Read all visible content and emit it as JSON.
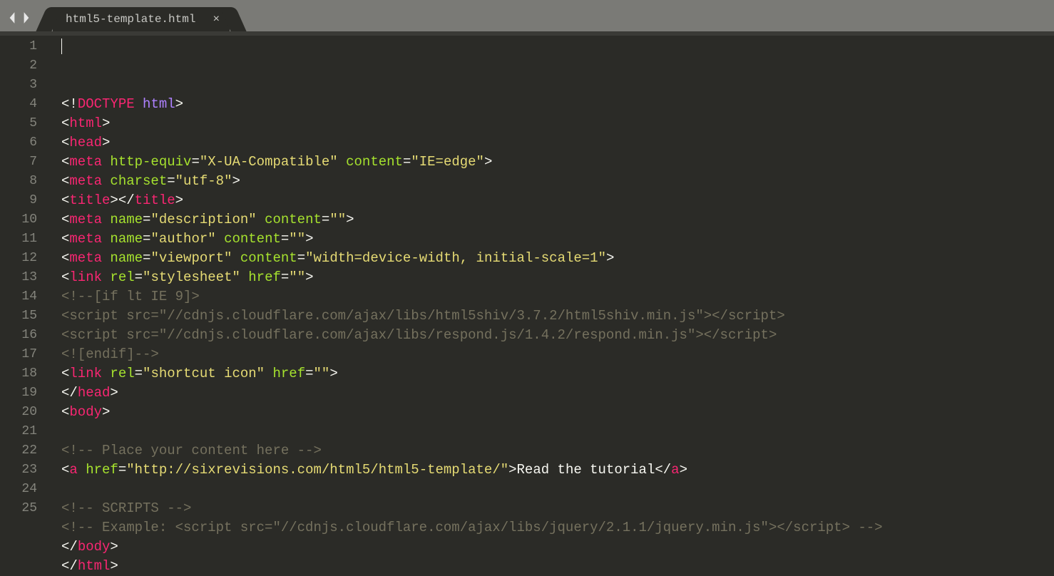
{
  "tab": {
    "filename": "html5-template.html",
    "close_glyph": "×"
  },
  "gutter_start": 1,
  "gutter_end": 25,
  "code": [
    [
      [
        "p-white",
        "<!"
      ],
      [
        "p-pink",
        "DOCTYPE"
      ],
      [
        "p-white",
        " "
      ],
      [
        "p-purple",
        "html"
      ],
      [
        "p-white",
        ">"
      ]
    ],
    [
      [
        "p-white",
        "<"
      ],
      [
        "p-pink",
        "html"
      ],
      [
        "p-white",
        ">"
      ]
    ],
    [
      [
        "p-white",
        "<"
      ],
      [
        "p-pink",
        "head"
      ],
      [
        "p-white",
        ">"
      ]
    ],
    [
      [
        "p-white",
        "<"
      ],
      [
        "p-pink",
        "meta"
      ],
      [
        "p-white",
        " "
      ],
      [
        "p-green",
        "http-equiv"
      ],
      [
        "p-white",
        "="
      ],
      [
        "p-yellow",
        "\"X-UA-Compatible\""
      ],
      [
        "p-white",
        " "
      ],
      [
        "p-green",
        "content"
      ],
      [
        "p-white",
        "="
      ],
      [
        "p-yellow",
        "\"IE=edge\""
      ],
      [
        "p-white",
        ">"
      ]
    ],
    [
      [
        "p-white",
        "<"
      ],
      [
        "p-pink",
        "meta"
      ],
      [
        "p-white",
        " "
      ],
      [
        "p-green",
        "charset"
      ],
      [
        "p-white",
        "="
      ],
      [
        "p-yellow",
        "\"utf-8\""
      ],
      [
        "p-white",
        ">"
      ]
    ],
    [
      [
        "p-white",
        "<"
      ],
      [
        "p-pink",
        "title"
      ],
      [
        "p-white",
        "></"
      ],
      [
        "p-pink",
        "title"
      ],
      [
        "p-white",
        ">"
      ]
    ],
    [
      [
        "p-white",
        "<"
      ],
      [
        "p-pink",
        "meta"
      ],
      [
        "p-white",
        " "
      ],
      [
        "p-green",
        "name"
      ],
      [
        "p-white",
        "="
      ],
      [
        "p-yellow",
        "\"description\""
      ],
      [
        "p-white",
        " "
      ],
      [
        "p-green",
        "content"
      ],
      [
        "p-white",
        "="
      ],
      [
        "p-yellow",
        "\"\""
      ],
      [
        "p-white",
        ">"
      ]
    ],
    [
      [
        "p-white",
        "<"
      ],
      [
        "p-pink",
        "meta"
      ],
      [
        "p-white",
        " "
      ],
      [
        "p-green",
        "name"
      ],
      [
        "p-white",
        "="
      ],
      [
        "p-yellow",
        "\"author\""
      ],
      [
        "p-white",
        " "
      ],
      [
        "p-green",
        "content"
      ],
      [
        "p-white",
        "="
      ],
      [
        "p-yellow",
        "\"\""
      ],
      [
        "p-white",
        ">"
      ]
    ],
    [
      [
        "p-white",
        "<"
      ],
      [
        "p-pink",
        "meta"
      ],
      [
        "p-white",
        " "
      ],
      [
        "p-green",
        "name"
      ],
      [
        "p-white",
        "="
      ],
      [
        "p-yellow",
        "\"viewport\""
      ],
      [
        "p-white",
        " "
      ],
      [
        "p-green",
        "content"
      ],
      [
        "p-white",
        "="
      ],
      [
        "p-yellow",
        "\"width=device-width, initial-scale=1\""
      ],
      [
        "p-white",
        ">"
      ]
    ],
    [
      [
        "p-white",
        "<"
      ],
      [
        "p-pink",
        "link"
      ],
      [
        "p-white",
        " "
      ],
      [
        "p-green",
        "rel"
      ],
      [
        "p-white",
        "="
      ],
      [
        "p-yellow",
        "\"stylesheet\""
      ],
      [
        "p-white",
        " "
      ],
      [
        "p-green",
        "href"
      ],
      [
        "p-white",
        "="
      ],
      [
        "p-yellow",
        "\"\""
      ],
      [
        "p-white",
        ">"
      ]
    ],
    [
      [
        "p-gray",
        "<!--[if lt IE 9]>"
      ]
    ],
    [
      [
        "p-gray",
        "<script src=\"//cdnjs.cloudflare.com/ajax/libs/html5shiv/3.7.2/html5shiv.min.js\"></script>"
      ]
    ],
    [
      [
        "p-gray",
        "<script src=\"//cdnjs.cloudflare.com/ajax/libs/respond.js/1.4.2/respond.min.js\"></script>"
      ]
    ],
    [
      [
        "p-gray",
        "<![endif]-->"
      ]
    ],
    [
      [
        "p-white",
        "<"
      ],
      [
        "p-pink",
        "link"
      ],
      [
        "p-white",
        " "
      ],
      [
        "p-green",
        "rel"
      ],
      [
        "p-white",
        "="
      ],
      [
        "p-yellow",
        "\"shortcut icon\""
      ],
      [
        "p-white",
        " "
      ],
      [
        "p-green",
        "href"
      ],
      [
        "p-white",
        "="
      ],
      [
        "p-yellow",
        "\"\""
      ],
      [
        "p-white",
        ">"
      ]
    ],
    [
      [
        "p-white",
        "</"
      ],
      [
        "p-pink",
        "head"
      ],
      [
        "p-white",
        ">"
      ]
    ],
    [
      [
        "p-white",
        "<"
      ],
      [
        "p-pink",
        "body"
      ],
      [
        "p-white",
        ">"
      ]
    ],
    [
      [
        "p-white",
        ""
      ]
    ],
    [
      [
        "p-gray",
        "<!-- Place your content here -->"
      ]
    ],
    [
      [
        "p-white",
        "<"
      ],
      [
        "p-pink",
        "a"
      ],
      [
        "p-white",
        " "
      ],
      [
        "p-green",
        "href"
      ],
      [
        "p-white",
        "="
      ],
      [
        "p-yellow",
        "\"http://sixrevisions.com/html5/html5-template/\""
      ],
      [
        "p-white",
        ">Read the tutorial</"
      ],
      [
        "p-pink",
        "a"
      ],
      [
        "p-white",
        ">"
      ]
    ],
    [
      [
        "p-white",
        ""
      ]
    ],
    [
      [
        "p-gray",
        "<!-- SCRIPTS -->"
      ]
    ],
    [
      [
        "p-gray",
        "<!-- Example: <script src=\"//cdnjs.cloudflare.com/ajax/libs/jquery/2.1.1/jquery.min.js\"></script> -->"
      ]
    ],
    [
      [
        "p-white",
        "</"
      ],
      [
        "p-pink",
        "body"
      ],
      [
        "p-white",
        ">"
      ]
    ],
    [
      [
        "p-white",
        "</"
      ],
      [
        "p-pink",
        "html"
      ],
      [
        "p-white",
        ">"
      ]
    ]
  ]
}
